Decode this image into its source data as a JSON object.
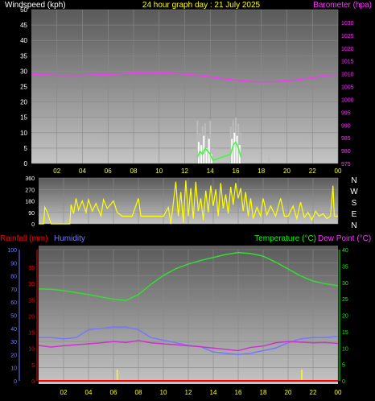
{
  "header": {
    "windspeed_label": "Windspeed (kph)",
    "title": "24 hour graph day : 21 July 2025",
    "barometer_label": "Barometer (hpa)"
  },
  "legend": {
    "rainfall": "Rainfall (mm)",
    "humidity": "Humidity",
    "temperature": "Temperature (°C)",
    "dewpoint": "Dew Point (°C)"
  },
  "colors": {
    "windspeed": "#ffffff",
    "windgust": "#bbbbbb",
    "windavg": "#33ff33",
    "barometer": "#ff33ff",
    "winddir": "#ffff00",
    "rainfall": "#ff0000",
    "humidity": "#7777ff",
    "temperature": "#33dd33",
    "dewpoint": "#cc33cc",
    "temp_axis": "#00ff00",
    "title": "#ffff00"
  },
  "time_ticks": [
    "02",
    "04",
    "06",
    "08",
    "10",
    "12",
    "14",
    "16",
    "18",
    "20",
    "22",
    "00"
  ],
  "compass_labels": [
    "N",
    "W",
    "S",
    "E",
    "N"
  ],
  "chart_data": [
    {
      "type": "line",
      "title": "24 hour graph day : 21 July 2025",
      "ylabel": "Windspeed (kph)",
      "ylabel_right": "Barometer (hpa)",
      "ylim": [
        0,
        50
      ],
      "y_ticks": [
        "0",
        "5",
        "10",
        "15",
        "20",
        "25",
        "30",
        "35",
        "40",
        "45",
        "50"
      ],
      "ylim_right": [
        975,
        1035
      ],
      "y_ticks_right": [
        "975",
        "980",
        "985",
        "990",
        "995",
        "1000",
        "1005",
        "1010",
        "1015",
        "1020",
        "1025",
        "1030"
      ],
      "x": [
        0,
        1,
        2,
        3,
        4,
        5,
        6,
        7,
        8,
        9,
        10,
        11,
        12,
        13,
        14,
        15,
        16,
        17,
        18,
        19,
        20,
        21,
        22,
        23,
        24
      ],
      "series": [
        {
          "key": "barometer",
          "axis": "right",
          "values": [
            1009.8,
            1009.6,
            1009.4,
            1009.3,
            1009.4,
            1009.6,
            1009.7,
            1010.0,
            1010.3,
            1010.5,
            1010.4,
            1010.2,
            1009.9,
            1009.4,
            1008.8,
            1008.1,
            1007.5,
            1007.0,
            1006.8,
            1006.9,
            1007.2,
            1007.8,
            1008.5,
            1009.2,
            1009.5
          ]
        },
        {
          "key": "windgust",
          "bars": [
            [
              13.0,
              14
            ],
            [
              13.2,
              10
            ],
            [
              13.4,
              12
            ],
            [
              13.6,
              13
            ],
            [
              13.8,
              9
            ],
            [
              14.0,
              14
            ],
            [
              14.2,
              5
            ],
            [
              15.6,
              12
            ],
            [
              15.8,
              14
            ],
            [
              16.0,
              15
            ],
            [
              16.2,
              13
            ],
            [
              16.4,
              10
            ],
            [
              18.6,
              2
            ]
          ]
        },
        {
          "key": "windspeed",
          "bars": [
            [
              13.1,
              7
            ],
            [
              13.3,
              6
            ],
            [
              13.5,
              9
            ],
            [
              13.7,
              5
            ],
            [
              13.9,
              8
            ],
            [
              14.1,
              3
            ],
            [
              15.7,
              8
            ],
            [
              15.9,
              10
            ],
            [
              16.1,
              9
            ],
            [
              16.3,
              6
            ]
          ]
        },
        {
          "key": "windavg",
          "points": [
            [
              13.0,
              2
            ],
            [
              13.2,
              4
            ],
            [
              13.4,
              3
            ],
            [
              13.6,
              5
            ],
            [
              13.8,
              4
            ],
            [
              14.0,
              3
            ],
            [
              14.2,
              1
            ],
            [
              15.6,
              3
            ],
            [
              15.8,
              6
            ],
            [
              16.0,
              7
            ],
            [
              16.2,
              5
            ],
            [
              16.4,
              2
            ]
          ]
        }
      ]
    },
    {
      "type": "line",
      "ylabel": "Wind direction",
      "ylim": [
        0,
        360
      ],
      "y_ticks": [
        "0",
        "90",
        "180",
        "270",
        "360"
      ],
      "series": [
        {
          "key": "winddir",
          "values": [
            [
              0.0,
              0
            ],
            [
              0.4,
              0
            ],
            [
              0.5,
              130
            ],
            [
              0.7,
              90
            ],
            [
              1.0,
              0
            ],
            [
              2.5,
              0
            ],
            [
              2.6,
              150
            ],
            [
              2.8,
              80
            ],
            [
              3.0,
              200
            ],
            [
              3.2,
              110
            ],
            [
              3.5,
              180
            ],
            [
              3.8,
              90
            ],
            [
              4.0,
              190
            ],
            [
              4.3,
              100
            ],
            [
              4.6,
              160
            ],
            [
              5.0,
              60
            ],
            [
              5.2,
              190
            ],
            [
              5.5,
              120
            ],
            [
              6.0,
              180
            ],
            [
              6.3,
              90
            ],
            [
              6.7,
              60
            ],
            [
              7.0,
              60
            ],
            [
              7.5,
              60
            ],
            [
              8.0,
              200
            ],
            [
              8.2,
              60
            ],
            [
              8.5,
              60
            ],
            [
              9.0,
              60
            ],
            [
              9.5,
              60
            ],
            [
              10.0,
              60
            ],
            [
              10.4,
              130
            ],
            [
              10.6,
              0
            ],
            [
              11.0,
              330
            ],
            [
              11.2,
              60
            ],
            [
              11.4,
              250
            ],
            [
              11.6,
              10
            ],
            [
              11.8,
              340
            ],
            [
              12.0,
              60
            ],
            [
              12.2,
              280
            ],
            [
              12.4,
              40
            ],
            [
              12.6,
              330
            ],
            [
              12.8,
              100
            ],
            [
              13.0,
              200
            ],
            [
              13.2,
              30
            ],
            [
              13.4,
              260
            ],
            [
              13.6,
              90
            ],
            [
              13.8,
              300
            ],
            [
              14.0,
              140
            ],
            [
              14.2,
              270
            ],
            [
              14.4,
              60
            ],
            [
              14.6,
              320
            ],
            [
              14.8,
              120
            ],
            [
              15.0,
              230
            ],
            [
              15.2,
              80
            ],
            [
              15.4,
              290
            ],
            [
              15.6,
              150
            ],
            [
              15.8,
              320
            ],
            [
              16.0,
              200
            ],
            [
              16.2,
              280
            ],
            [
              16.4,
              100
            ],
            [
              16.6,
              250
            ],
            [
              16.8,
              60
            ],
            [
              17.0,
              200
            ],
            [
              17.2,
              40
            ],
            [
              17.5,
              130
            ],
            [
              17.8,
              60
            ],
            [
              18.0,
              200
            ],
            [
              18.3,
              70
            ],
            [
              18.6,
              140
            ],
            [
              19.0,
              60
            ],
            [
              19.4,
              200
            ],
            [
              19.7,
              60
            ],
            [
              20.0,
              60
            ],
            [
              20.4,
              140
            ],
            [
              20.7,
              40
            ],
            [
              21.0,
              170
            ],
            [
              21.3,
              50
            ],
            [
              21.6,
              90
            ],
            [
              21.9,
              30
            ],
            [
              22.2,
              100
            ],
            [
              22.5,
              60
            ],
            [
              22.8,
              80
            ],
            [
              23.1,
              40
            ],
            [
              23.4,
              60
            ],
            [
              23.6,
              300
            ],
            [
              23.7,
              60
            ],
            [
              24.0,
              60
            ]
          ]
        }
      ]
    },
    {
      "type": "line",
      "ylabel": "Rainfall (mm) / Humidity",
      "ylabel_right": "Temperature (°C) / Dew Point (°C)",
      "ylim": [
        0,
        100
      ],
      "y_ticks": [
        "0",
        "10",
        "20",
        "30",
        "40",
        "50",
        "60",
        "70",
        "80",
        "90",
        "100"
      ],
      "rain_ticks": [
        "0",
        "5",
        "10",
        "15",
        "20",
        "25",
        "30",
        "35"
      ],
      "ylim_right": [
        0,
        40
      ],
      "y_ticks_right": [
        "0",
        "5",
        "10",
        "15",
        "20",
        "25",
        "30",
        "35",
        "40"
      ],
      "x": [
        0,
        1,
        2,
        3,
        4,
        5,
        6,
        7,
        8,
        9,
        10,
        11,
        12,
        13,
        14,
        15,
        16,
        17,
        18,
        19,
        20,
        21,
        22,
        23,
        24
      ],
      "series": [
        {
          "key": "temperature",
          "axis": "right",
          "values": [
            28.0,
            27.9,
            27.5,
            26.9,
            26.3,
            25.6,
            24.9,
            24.5,
            26.3,
            29.4,
            32.1,
            34.2,
            35.6,
            36.7,
            37.6,
            38.5,
            39.1,
            38.8,
            38.0,
            36.2,
            34.1,
            32.0,
            30.4,
            29.6,
            29.0
          ]
        },
        {
          "key": "dewpoint",
          "axis": "right",
          "values": [
            10.8,
            10.3,
            10.7,
            11.0,
            11.3,
            11.6,
            12.0,
            11.7,
            12.3,
            11.6,
            11.3,
            11.0,
            10.7,
            10.4,
            10.0,
            9.6,
            9.2,
            10.2,
            10.6,
            11.6,
            12.0,
            11.8,
            11.6,
            11.7,
            11.4
          ]
        },
        {
          "key": "humidity",
          "axis": "left",
          "values": [
            33,
            33,
            32,
            33,
            39,
            40,
            41,
            41,
            39,
            33,
            31,
            29,
            27,
            26,
            22,
            21,
            20,
            21,
            23,
            25,
            29,
            32,
            33,
            33,
            34
          ]
        },
        {
          "key": "rainfall",
          "axis": "left",
          "values": [
            0,
            0,
            0,
            0,
            0,
            0,
            0,
            0,
            0,
            0,
            0,
            0,
            0,
            0,
            0,
            0,
            0,
            0,
            0,
            0,
            0,
            0,
            0,
            0,
            0
          ]
        }
      ],
      "markers": [
        6.3,
        21.1
      ]
    }
  ]
}
